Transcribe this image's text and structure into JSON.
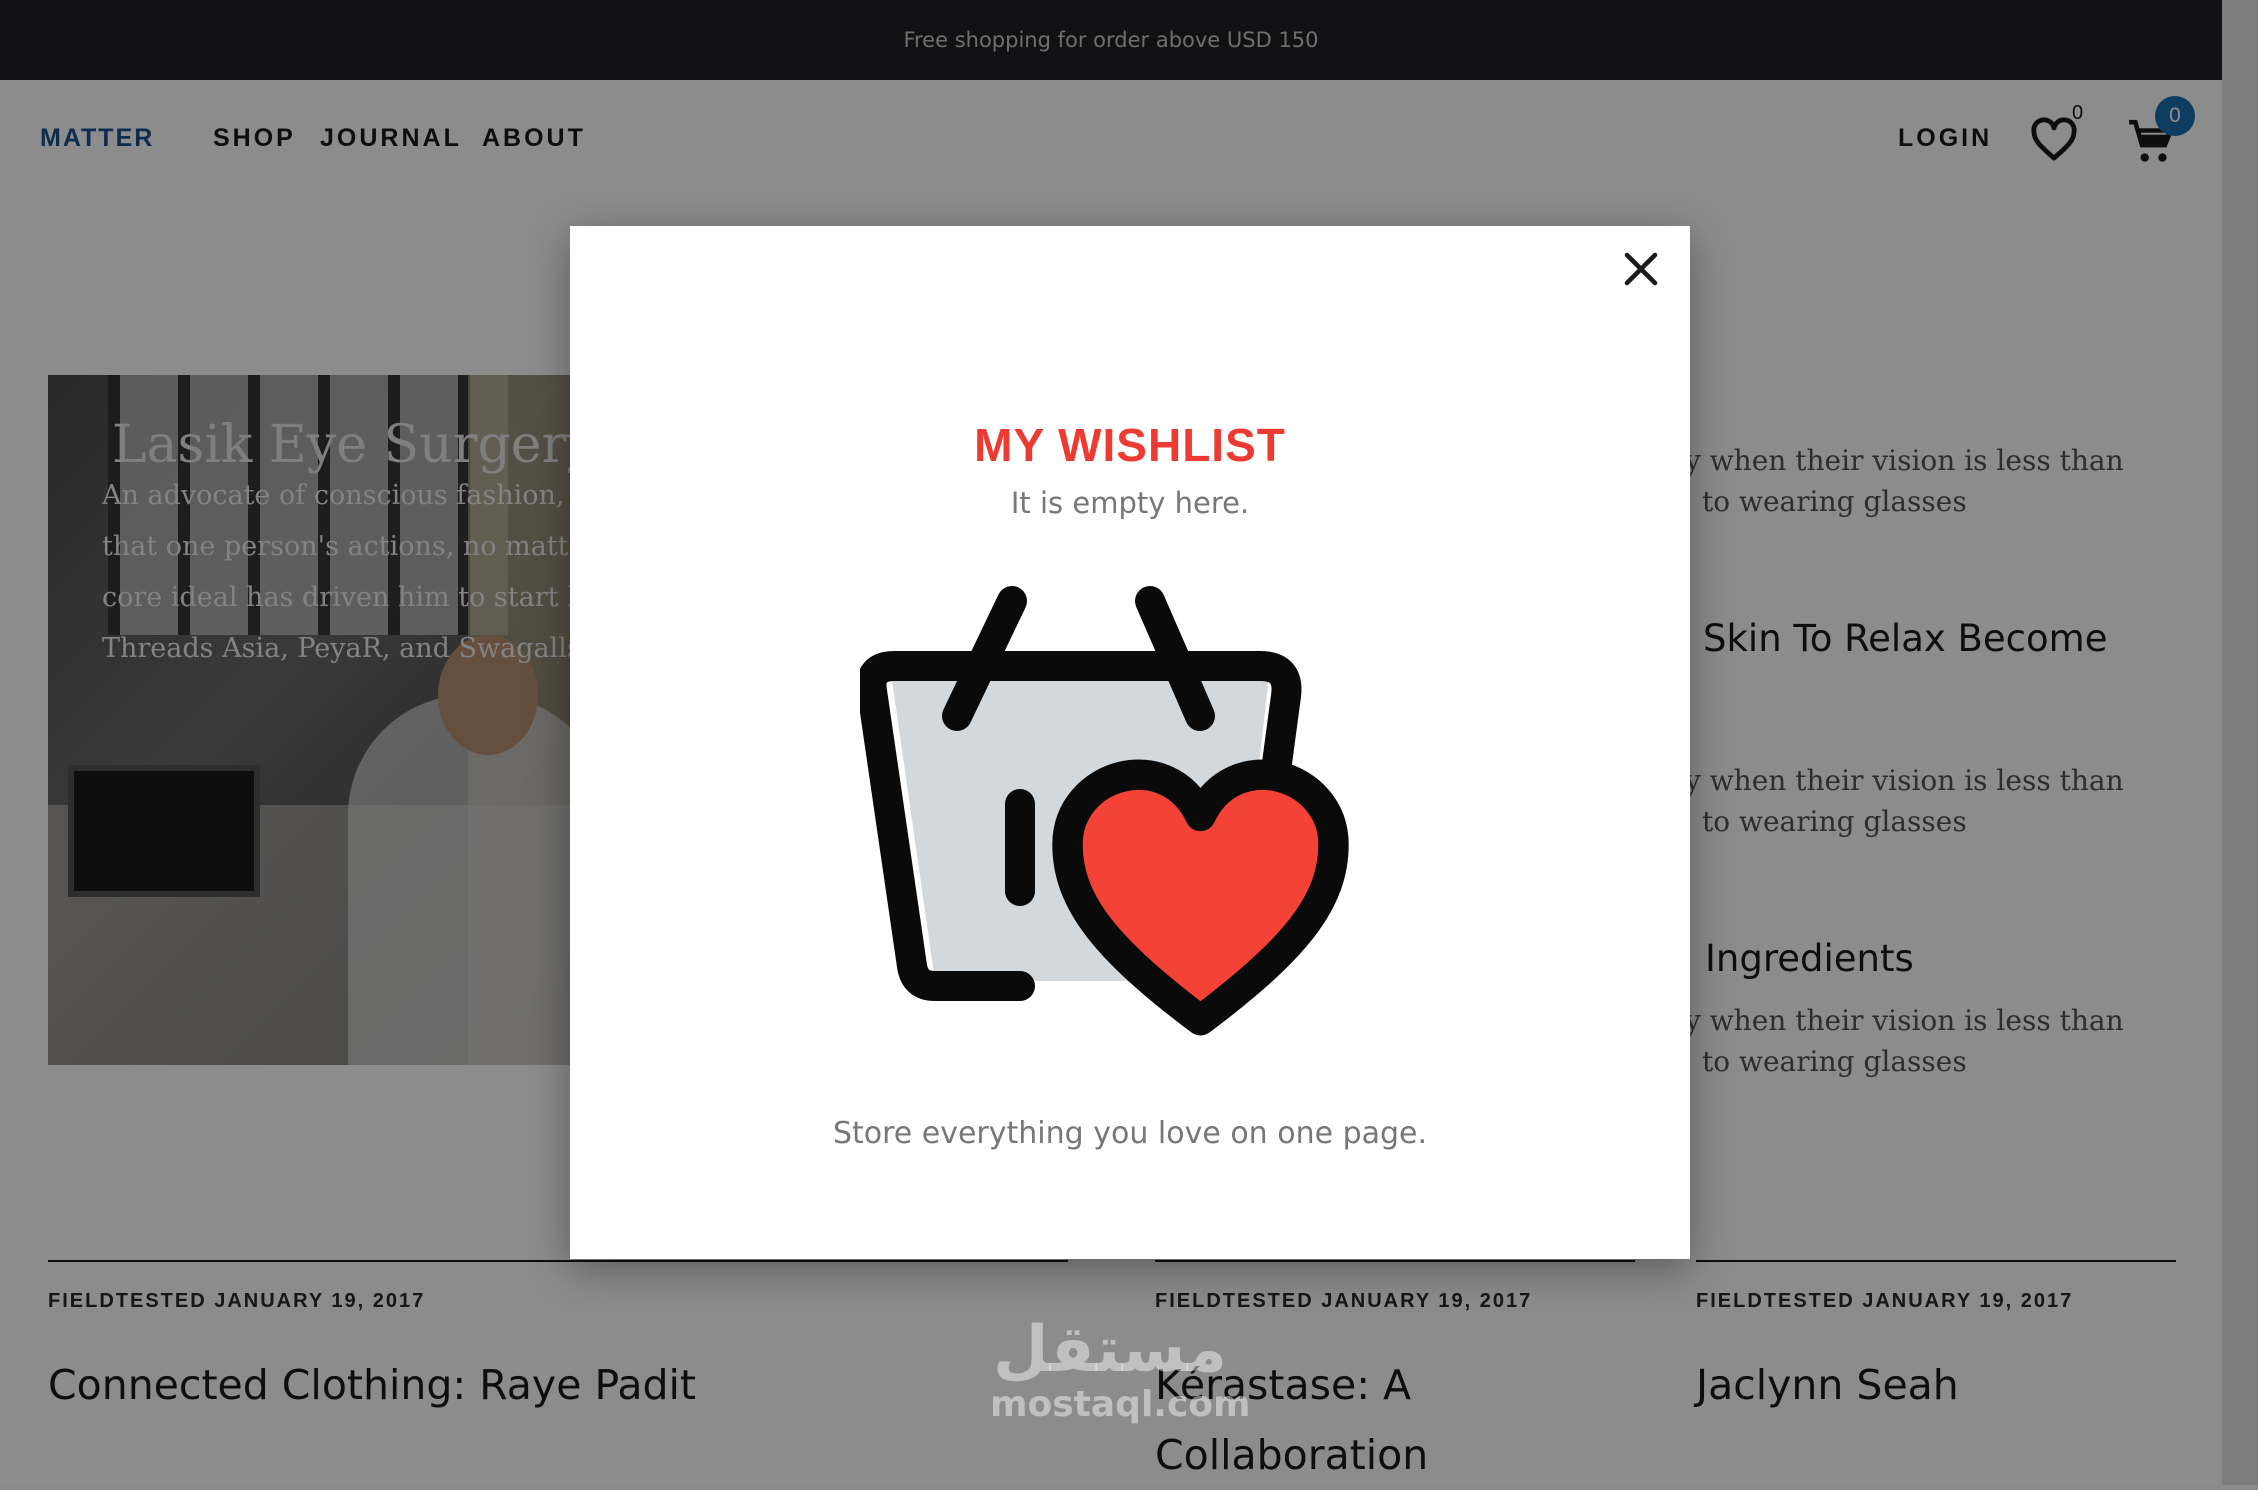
{
  "announcement": "Free shopping for order above USD 150",
  "nav": {
    "logo": "MATTER",
    "links": [
      "SHOP",
      "JOURNAL",
      "ABOUT"
    ],
    "login": "LOGIN",
    "wishlist_count": "0",
    "cart_count": "0",
    "accent_color": "#1d4f8c",
    "badge_color": "#1c6fb0"
  },
  "hero": {
    "title": "Lasik Eye Surgery A",
    "text_lines": [
      "An advocate of conscious fashion, Ra",
      "that one person's actions, no matter h",
      "core ideal has driven him to start his",
      "Threads Asia, PeyaR, and Swagalls."
    ]
  },
  "sidebar": {
    "excerpt_line1": "y when their vision is less than",
    "excerpt_line2": "to wearing glasses",
    "title_1": "Skin To Relax Become",
    "title_2": "Ingredients"
  },
  "cards": [
    {
      "meta": "FIELDTESTED JANUARY 19, 2017",
      "title_lines": [
        "Connected Clothing: Raye Padit"
      ]
    },
    {
      "meta": "FIELDTESTED JANUARY 19, 2017",
      "title_lines": [
        "Kérastase: A",
        "Collaboration"
      ]
    },
    {
      "meta": "FIELDTESTED JANUARY 19, 2017",
      "title_lines": [
        "Jaclynn Seah"
      ]
    }
  ],
  "modal": {
    "title": "MY WISHLIST",
    "subtitle": "It is empty here.",
    "footer": "Store everything you love on one page.",
    "title_color": "#ee3b32",
    "heart_color": "#f44336",
    "close_icon": "close-icon",
    "illustration": "empty-basket-heart-icon"
  },
  "watermark": {
    "arabic": "مستقل",
    "latin": "mostaql.com"
  }
}
